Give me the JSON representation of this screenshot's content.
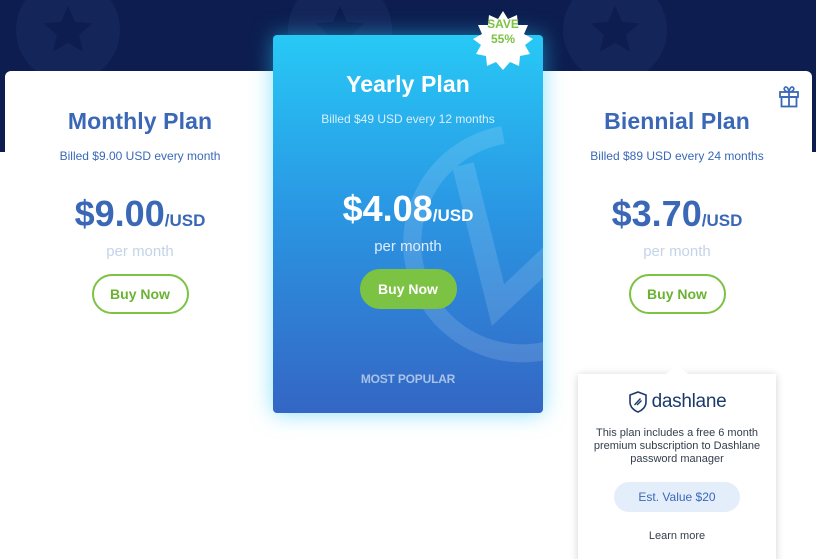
{
  "badge": {
    "line1": "SAVE",
    "line2": "55%"
  },
  "plans": [
    {
      "title": "Monthly Plan",
      "billed": "Billed $9.00 USD every month",
      "price": "$9.00",
      "unit": "/USD",
      "period": "per month",
      "button": "Buy Now"
    },
    {
      "title": "Yearly Plan",
      "billed": "Billed $49 USD every 12 months",
      "price": "$4.08",
      "unit": "/USD",
      "period": "per month",
      "button": "Buy Now",
      "tag": "MOST POPULAR"
    },
    {
      "title": "Biennial Plan",
      "billed": "Billed $89 USD every 24 months",
      "price": "$3.70",
      "unit": "/USD",
      "period": "per month",
      "button": "Buy Now"
    }
  ],
  "dashlane": {
    "brand": "dashlane",
    "description": "This plan includes a free 6 month premium subscription to Dashlane password manager",
    "est_value": "Est. Value $20",
    "learn_more": "Learn more"
  },
  "icons": {
    "gift": "gift-icon",
    "shield": "dashlane-shield-icon",
    "stars": "star-icon"
  },
  "colors": {
    "hero": "#0d1d4f",
    "accent_blue": "#3a68b7",
    "accent_green": "#7cc243",
    "highlight_top": "#27c9f6",
    "highlight_bottom": "#3466c4"
  }
}
